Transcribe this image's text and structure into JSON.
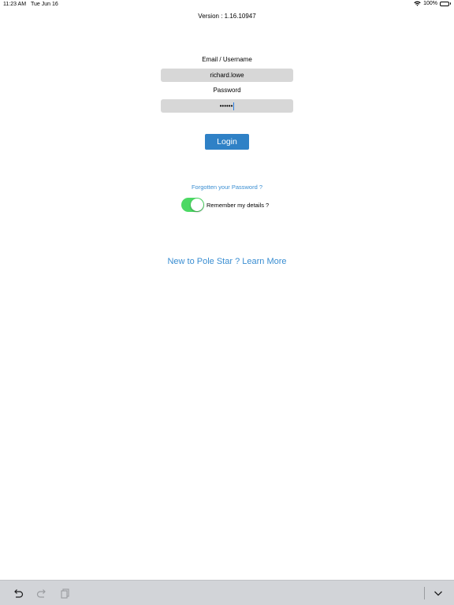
{
  "status_bar": {
    "time": "11:23 AM",
    "date": "Tue Jun 16",
    "battery": "100%",
    "icons": [
      "wifi-icon",
      "battery-icon"
    ]
  },
  "version": "Version : 1.16.10947",
  "form": {
    "email_label": "Email / Username",
    "email_value": "richard.lowe",
    "password_label": "Password",
    "password_masked": "••••••",
    "login_label": "Login",
    "forgot_link": "Forgotten your Password ?",
    "remember_label": "Remember my details ?",
    "remember_on": true
  },
  "learn_more": "New to Pole Star ? Learn More",
  "keyboard_bar": {
    "icons": [
      "undo-icon",
      "redo-icon",
      "paste-icon",
      "dismiss-keyboard-icon"
    ]
  },
  "colors": {
    "accent": "#2f81c6",
    "link": "#3a8ed2",
    "toggle_on": "#4cd964",
    "field_bg": "#d7d7d7",
    "keyboard_bar_bg": "#d2d4d8"
  }
}
